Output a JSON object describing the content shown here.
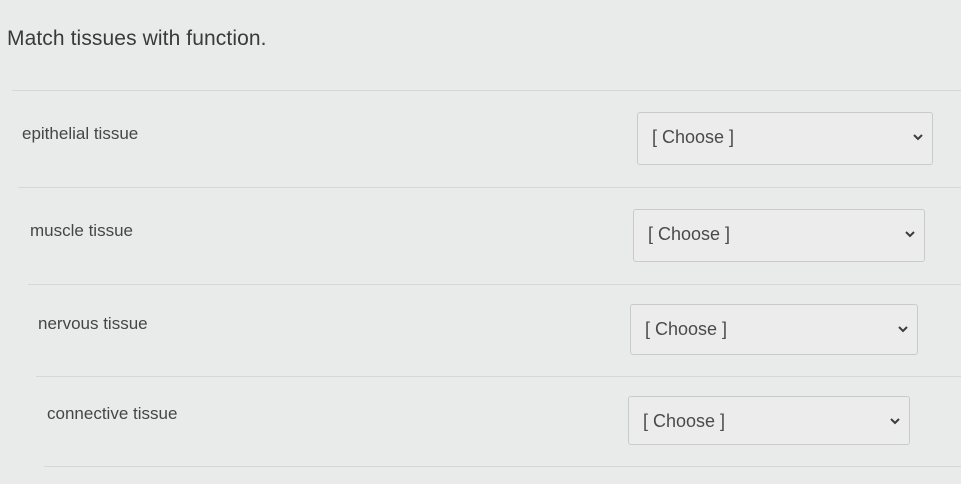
{
  "question": {
    "prompt": "Match tissues with function.",
    "rows": [
      {
        "label": "epithelial tissue",
        "selected": "[ Choose ]"
      },
      {
        "label": "muscle tissue",
        "selected": "[ Choose ]"
      },
      {
        "label": "nervous tissue",
        "selected": "[ Choose ]"
      },
      {
        "label": "connective tissue",
        "selected": "[ Choose ]"
      }
    ],
    "dropdown_icon": "chevron-down-icon"
  }
}
